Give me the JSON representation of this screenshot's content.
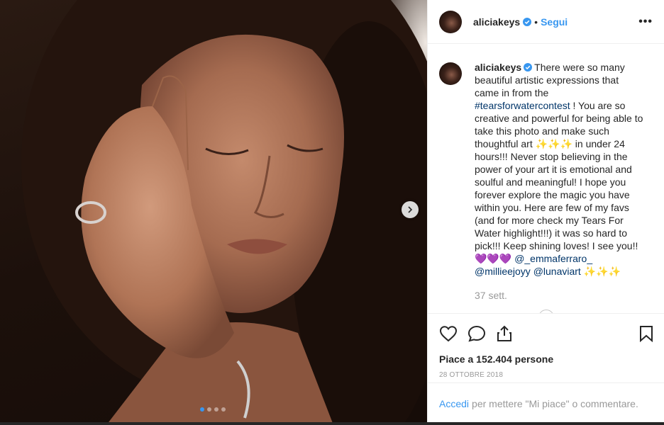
{
  "post": {
    "image_alt": "Foto di aliciakeys",
    "carousel": {
      "total": 4,
      "active": 1
    }
  },
  "header": {
    "username": "aliciakeys",
    "separator": "•",
    "follow_label": "Segui",
    "more_label": "•••"
  },
  "caption": {
    "username": "aliciakeys",
    "text_1": "There were so many beautiful artistic expressions that came in from the ",
    "hashtag": "#tearsforwatercontest",
    "text_2": " ! You are so creative and powerful for being able to take this photo and make such thoughtful art ✨✨✨ in under 24 hours!!! Never stop believing in the power of your art it is emotional and soulful and meaningful! I hope you forever explore the magic you have within you. Here are few of my favs (and for more check my Tears For Water highlight!!!) it was so hard to pick!!! Keep shining loves! I see you!! 💜💜💜 ",
    "mention_1": "@_emmaferraro_",
    "mention_2": "@millieejoyy",
    "mention_3": "@lunaviart",
    "text_3": " ✨✨✨",
    "age": "37 sett."
  },
  "stats": {
    "likes": "Piace a 152.404 persone",
    "date": "28 OTTOBRE 2018"
  },
  "login_prompt": {
    "link": "Accedi",
    "text": "per mettere \"Mi piace\" o commentare."
  },
  "colors": {
    "link_blue": "#3897f0",
    "hashtag_blue": "#003569",
    "muted": "#999999",
    "text": "#262626",
    "border": "#efefef"
  },
  "icons": [
    "heart-icon",
    "comment-icon",
    "share-icon",
    "bookmark-icon",
    "verified-badge-icon",
    "chevron-right-icon",
    "more-icon"
  ]
}
